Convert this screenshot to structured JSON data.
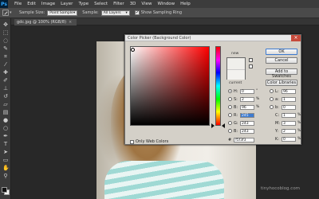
{
  "app": {
    "logo_text": "Ps"
  },
  "menu": [
    "File",
    "Edit",
    "Image",
    "Layer",
    "Type",
    "Select",
    "Filter",
    "3D",
    "View",
    "Window",
    "Help"
  ],
  "options_bar": {
    "sample_size_label": "Sample Size:",
    "sample_size_value": "Point Sample",
    "sample_label": "Sample:",
    "sample_value": "All Layers",
    "show_ring_label": "Show Sampling Ring",
    "show_ring_checked": true
  },
  "document": {
    "tab_title": "gdc.jpg @ 100% (RGB/8)",
    "close_glyph": "×"
  },
  "tools": [
    {
      "icon": "move-icon",
      "glyph": "✥"
    },
    {
      "icon": "marquee-icon",
      "glyph": "⬚"
    },
    {
      "icon": "lasso-icon",
      "glyph": "◌"
    },
    {
      "icon": "quick-select-icon",
      "glyph": "✎"
    },
    {
      "icon": "crop-icon",
      "glyph": "⌗"
    },
    {
      "icon": "eyedropper-icon",
      "glyph": "⁄"
    },
    {
      "icon": "healing-brush-icon",
      "glyph": "✚"
    },
    {
      "icon": "brush-icon",
      "glyph": "✐"
    },
    {
      "icon": "clone-stamp-icon",
      "glyph": "⊥"
    },
    {
      "icon": "history-brush-icon",
      "glyph": "↺"
    },
    {
      "icon": "eraser-icon",
      "glyph": "▱"
    },
    {
      "icon": "gradient-icon",
      "glyph": "▤"
    },
    {
      "icon": "blur-icon",
      "glyph": "●"
    },
    {
      "icon": "dodge-icon",
      "glyph": "○"
    },
    {
      "icon": "pen-icon",
      "glyph": "✒"
    },
    {
      "icon": "type-icon",
      "glyph": "T"
    },
    {
      "icon": "path-select-icon",
      "glyph": "➤"
    },
    {
      "icon": "shape-icon",
      "glyph": "▭"
    },
    {
      "icon": "hand-icon",
      "glyph": "✋"
    },
    {
      "icon": "zoom-icon",
      "glyph": "⚲"
    }
  ],
  "color_picker": {
    "title": "Color Picker (Background Color)",
    "close_glyph": "×",
    "label_new": "new",
    "label_current": "current",
    "new_color": "#f0efeb",
    "current_color": "#f3f2ef",
    "buttons": {
      "ok": "OK",
      "cancel": "Cancel",
      "add_to_swatches": "Add to Swatches",
      "color_libraries": "Color Libraries"
    },
    "fields_left": [
      {
        "label": "H:",
        "value": "0",
        "unit": "°",
        "selected": true,
        "highlight": false
      },
      {
        "label": "S:",
        "value": "2",
        "unit": "%",
        "selected": false,
        "highlight": false
      },
      {
        "label": "B:",
        "value": "96",
        "unit": "%",
        "selected": false,
        "highlight": false
      },
      {
        "label": "R:",
        "value": "245",
        "unit": "",
        "selected": false,
        "highlight": true
      },
      {
        "label": "G:",
        "value": "243",
        "unit": "",
        "selected": false,
        "highlight": false
      },
      {
        "label": "B:",
        "value": "243",
        "unit": "",
        "selected": false,
        "highlight": false
      }
    ],
    "fields_right": [
      {
        "label": "L:",
        "value": "96",
        "unit": ""
      },
      {
        "label": "a:",
        "value": "1",
        "unit": ""
      },
      {
        "label": "b:",
        "value": "0",
        "unit": ""
      },
      {
        "label": "C:",
        "value": "1",
        "unit": "%"
      },
      {
        "label": "M:",
        "value": "3",
        "unit": "%"
      },
      {
        "label": "Y:",
        "value": "2",
        "unit": "%"
      },
      {
        "label": "K:",
        "value": "0",
        "unit": "%"
      }
    ],
    "only_web_colors": "Only Web Colors",
    "hex_label": "#",
    "hex_value": "f5f3f3"
  },
  "watermark": "tinyhocoblog.com"
}
